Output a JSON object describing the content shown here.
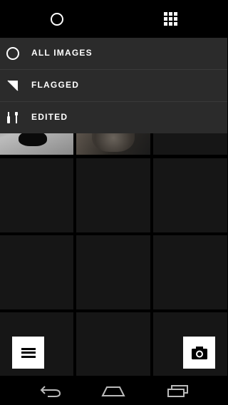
{
  "top_tabs": [
    {
      "icon": "circle-icon",
      "active": true
    },
    {
      "icon": "grid-icon",
      "active": false
    }
  ],
  "menu": {
    "items": [
      {
        "icon": "circle-icon",
        "label": "ALL IMAGES"
      },
      {
        "icon": "flag-icon",
        "label": "FLAGGED"
      },
      {
        "icon": "edit-tools-icon",
        "label": "EDITED"
      }
    ],
    "background": "#2b2b2b"
  },
  "grid": {
    "columns": 3,
    "cell_color": "#161616"
  },
  "buttons": {
    "menu": "hamburger-icon",
    "camera": "camera-icon"
  },
  "nav_bar": [
    "back-icon",
    "home-icon",
    "recent-apps-icon"
  ]
}
